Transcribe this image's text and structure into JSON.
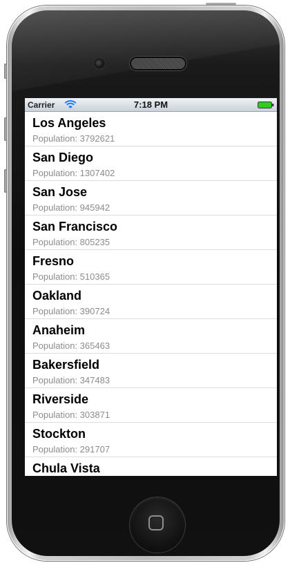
{
  "status_bar": {
    "carrier": "Carrier",
    "time": "7:18 PM",
    "wifi_icon": "wifi-icon",
    "battery_icon": "battery-full-icon",
    "battery_color": "#2ecc1f"
  },
  "list": {
    "population_prefix": "Population: ",
    "rows": [
      {
        "city": "Los Angeles",
        "population": "3792621"
      },
      {
        "city": "San Diego",
        "population": "1307402"
      },
      {
        "city": "San Jose",
        "population": "945942"
      },
      {
        "city": "San Francisco",
        "population": "805235"
      },
      {
        "city": "Fresno",
        "population": "510365"
      },
      {
        "city": "Oakland",
        "population": "390724"
      },
      {
        "city": "Anaheim",
        "population": "365463"
      },
      {
        "city": "Bakersfield",
        "population": "347483"
      },
      {
        "city": "Riverside",
        "population": "303871"
      },
      {
        "city": "Stockton",
        "population": "291707"
      },
      {
        "city": "Chula Vista",
        "population": ""
      }
    ]
  },
  "device": {
    "home_button_icon": "home-square-icon",
    "accent_ios_blue": "#1e7cf2"
  }
}
